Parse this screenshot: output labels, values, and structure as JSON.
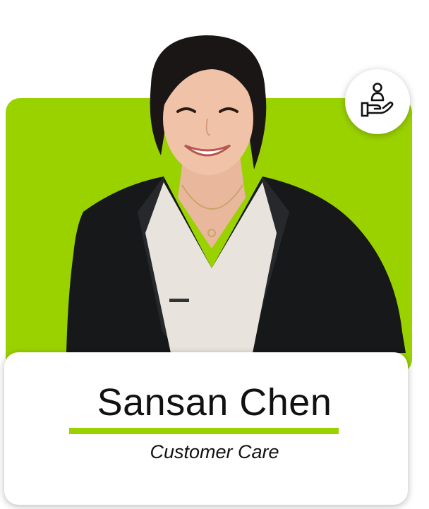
{
  "profile": {
    "name": "Sansan Chen",
    "role": "Customer Care",
    "badge_icon": "hand-holding-person-icon",
    "portrait_icon": "person-portrait-photo"
  },
  "colors": {
    "accent_green": "#9ad200",
    "card_background": "#ffffff",
    "text": "#111111"
  }
}
